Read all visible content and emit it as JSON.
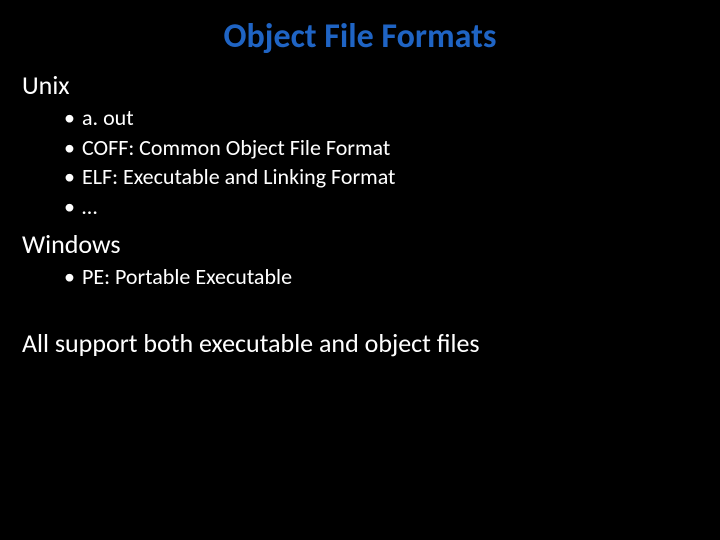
{
  "title": "Object File Formats",
  "sections": [
    {
      "heading": "Unix",
      "items": [
        "a. out",
        "COFF: Common Object File Format",
        "ELF: Executable and Linking Format",
        "…"
      ]
    },
    {
      "heading": "Windows",
      "items": [
        "PE: Portable Executable"
      ]
    }
  ],
  "footnote": "All support both executable and object files"
}
